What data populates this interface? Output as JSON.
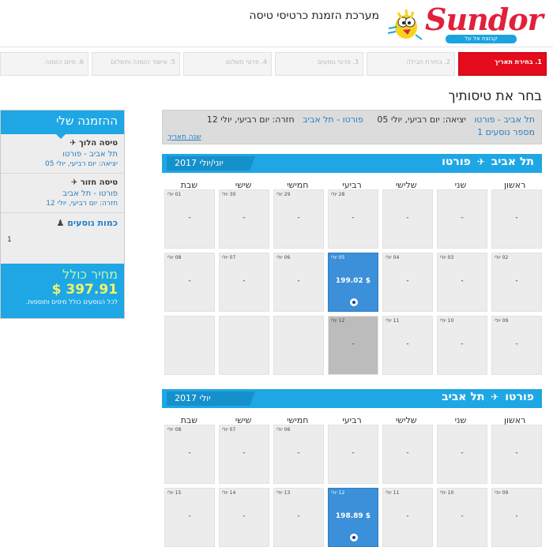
{
  "header": {
    "logo_text": "Sundor",
    "logo_sub": "קבוצת אל על",
    "site_title": "מערכת הזמנת כרטיסי טיסה"
  },
  "steps": [
    {
      "label": "1. בחירת תאריך",
      "active": true
    },
    {
      "label": "2. בחירת חבילה"
    },
    {
      "label": "3. פרטי נוסעים"
    },
    {
      "label": "4. פרטי תשלום"
    },
    {
      "label": "5. אישור הזמנה ותשלום"
    },
    {
      "label": "6. סיום הזמנה"
    }
  ],
  "page_title": "בחר את טיסותיך",
  "summary": {
    "out_route": "תל אביב - פורטו",
    "out_date": "יציאה: יום רביעי, יולי 05",
    "ret_route": "פורטו - תל אביב",
    "ret_date": "חזרה: יום רביעי, יולי 12",
    "passengers": "מספר נוסעים 1",
    "change": "שנה תאריך"
  },
  "days": [
    "ראשון",
    "שני",
    "שלישי",
    "רביעי",
    "חמישי",
    "שישי",
    "שבת"
  ],
  "outbound": {
    "route": "תל אביב ⟶ פורטו",
    "route_a": "תל אביב",
    "route_b": "פורטו",
    "month": "יוני/יולי 2017",
    "cells": [
      {
        "d": "",
        "p": "-"
      },
      {
        "d": "",
        "p": "-"
      },
      {
        "d": "",
        "p": "-"
      },
      {
        "d": "28",
        "p": "-"
      },
      {
        "d": "29",
        "p": "-"
      },
      {
        "d": "30",
        "p": "-"
      },
      {
        "d": "01",
        "p": "-"
      },
      {
        "d": "02",
        "p": "-"
      },
      {
        "d": "03",
        "p": "-"
      },
      {
        "d": "04",
        "p": "-"
      },
      {
        "d": "05",
        "p": "$ 199.02",
        "sel": true
      },
      {
        "d": "06",
        "p": "-"
      },
      {
        "d": "07",
        "p": "-"
      },
      {
        "d": "08",
        "p": "-"
      },
      {
        "d": "09",
        "p": "-"
      },
      {
        "d": "10",
        "p": "-"
      },
      {
        "d": "11",
        "p": "-"
      },
      {
        "d": "12",
        "p": "-",
        "dim": true
      },
      {
        "d": "",
        "p": ""
      },
      {
        "d": "",
        "p": ""
      },
      {
        "d": "",
        "p": ""
      }
    ]
  },
  "inbound": {
    "route_a": "פורטו",
    "route_b": "תל אביב",
    "month": "יולי 2017",
    "cells": [
      {
        "d": "",
        "p": "-"
      },
      {
        "d": "",
        "p": "-"
      },
      {
        "d": "",
        "p": "-"
      },
      {
        "d": "",
        "p": "-"
      },
      {
        "d": "06",
        "p": "-"
      },
      {
        "d": "07",
        "p": "-"
      },
      {
        "d": "08",
        "p": "-"
      },
      {
        "d": "09",
        "p": "-"
      },
      {
        "d": "10",
        "p": "-"
      },
      {
        "d": "11",
        "p": "-"
      },
      {
        "d": "12",
        "p": "$ 198.89",
        "sel": true
      },
      {
        "d": "13",
        "p": "-"
      },
      {
        "d": "14",
        "p": "-"
      },
      {
        "d": "15",
        "p": "-"
      }
    ]
  },
  "sidebar": {
    "title": "ההזמנה שלי",
    "out_title": "טיסה הלוך",
    "out_route": "תל אביב - פורטו",
    "out_date": "יציאה: יום רביעי, יולי 05",
    "ret_title": "טיסה חזור",
    "ret_route": "פורטו - תל אביב",
    "ret_date": "חזרה: יום רביעי, יולי 12",
    "pass_title": "כמות נוסעים",
    "pass_count": "1",
    "total_label": "מחיר כולל",
    "total_amount": "$ 397.91",
    "total_note": "לכל הנוסעים כולל מיסים ותוספות."
  },
  "colors": {
    "accent": "#1ea7e4",
    "active_step": "#e30b1c",
    "selected": "#3c8fd9"
  },
  "cell_date_prefix": "יולי"
}
